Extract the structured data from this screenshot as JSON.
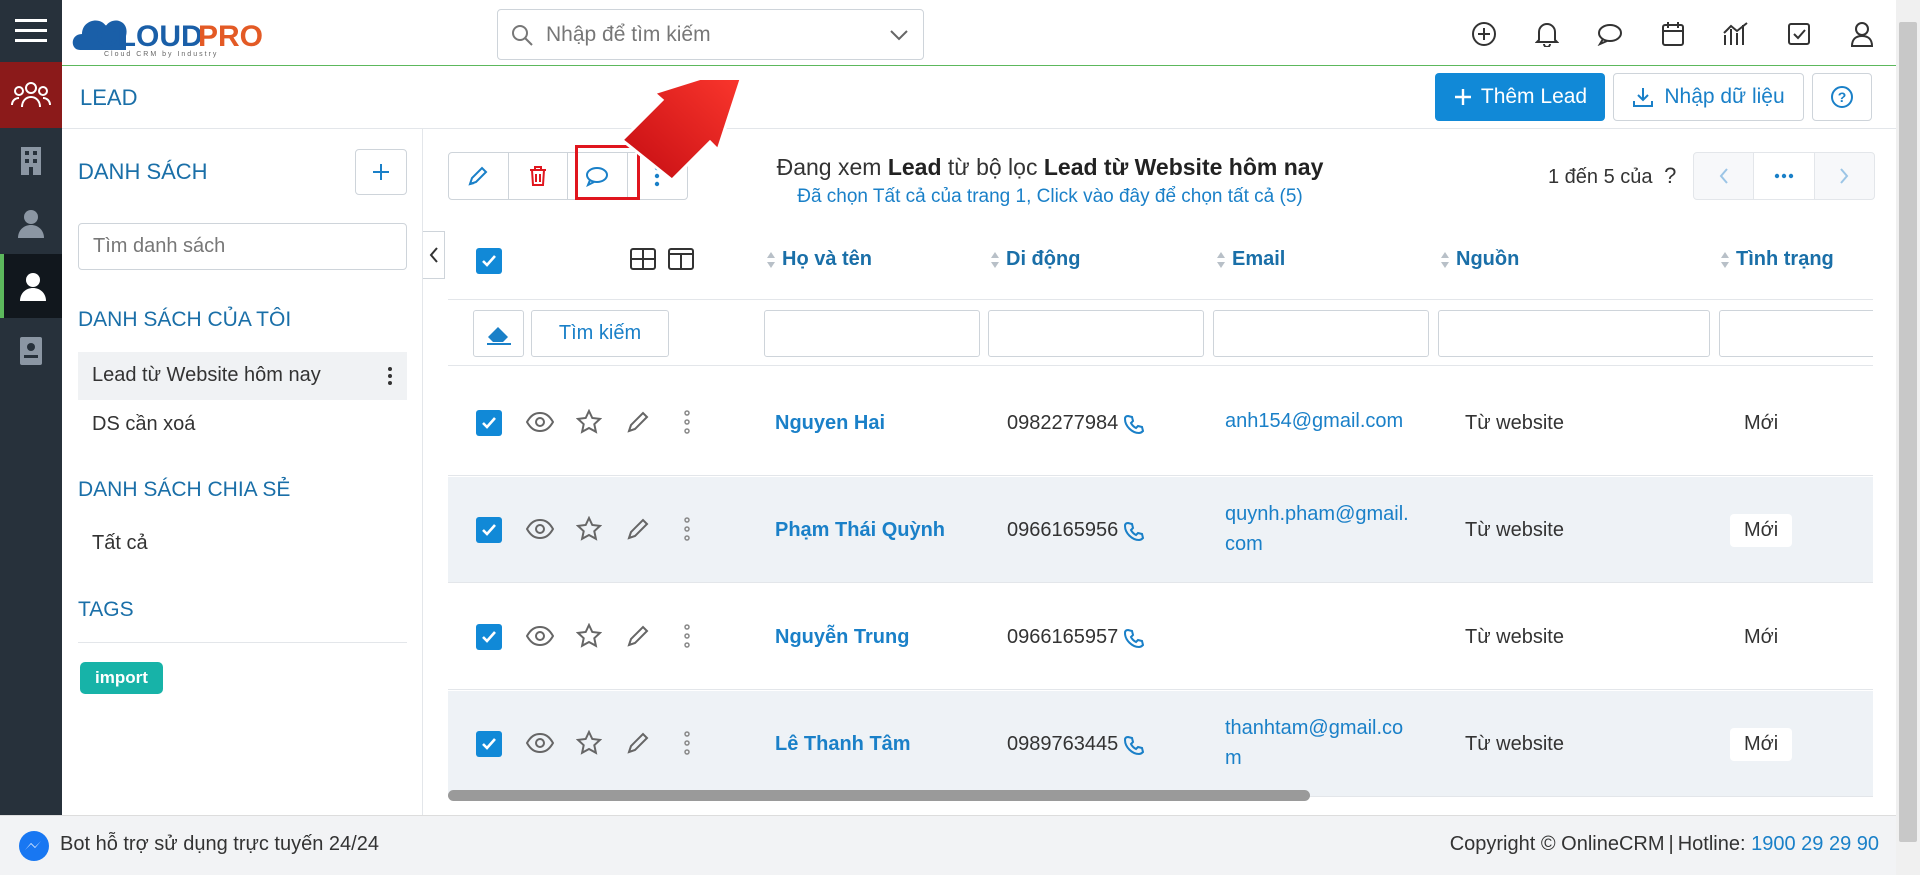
{
  "app": {
    "logo_text": "CLOUDPRO",
    "logo_tagline": "Cloud CRM by Industry"
  },
  "search": {
    "placeholder": "Nhập để tìm kiếm"
  },
  "page": {
    "title": "LEAD"
  },
  "actions": {
    "add_lead": "Thêm Lead",
    "import": "Nhập dữ liệu"
  },
  "left_panel": {
    "header": "DANH SÁCH",
    "search_placeholder": "Tìm danh sách",
    "my_lists_title": "DANH SÁCH CỦA TÔI",
    "my_lists": [
      "Lead từ Website hôm nay",
      "DS cần xoá"
    ],
    "shared_title": "DANH SÁCH CHIA SẺ",
    "shared_lists": [
      "Tất cả"
    ],
    "tags_title": "TAGS",
    "tags": [
      "import"
    ]
  },
  "toolbar": {
    "viewing_prefix": "Đang xem",
    "viewing_module": "Lead",
    "viewing_mid": "từ bộ lọc",
    "viewing_filter": "Lead từ Website hôm nay",
    "selection_info": "Đã chọn Tất cả của trang 1, Click vào đây để chọn tất cả (5)"
  },
  "pagination": {
    "range": "1 đến 5 của",
    "unknown": "?"
  },
  "table": {
    "columns": [
      "Họ và tên",
      "Di động",
      "Email",
      "Nguồn",
      "Tình trạng"
    ],
    "search_button": "Tìm kiếm",
    "rows": [
      {
        "name": "Nguyen Hai",
        "phone": "0982277984",
        "email_l1": "anh154@gmail.com",
        "email_l2": "",
        "source": "Từ website",
        "status": "Mới"
      },
      {
        "name": "Phạm Thái Quỳnh",
        "phone": "0966165956",
        "email_l1": "quynh.pham@gmail.",
        "email_l2": "com",
        "source": "Từ website",
        "status": "Mới"
      },
      {
        "name": "Nguyễn Trung",
        "phone": "0966165957",
        "email_l1": "",
        "email_l2": "",
        "source": "Từ website",
        "status": "Mới"
      },
      {
        "name": "Lê Thanh Tâm",
        "phone": "0989763445",
        "email_l1": "thanhtam@gmail.co",
        "email_l2": "m",
        "source": "Từ website",
        "status": "Mới"
      }
    ]
  },
  "footer": {
    "bot_text": "Bot hỗ trợ sử dụng trực tuyến 24/24",
    "copyright": "Copyright © OnlineCRM",
    "hotline_label": "Hotline:",
    "hotline": "1900 29 29 90"
  },
  "colors": {
    "primary": "#1189d7",
    "rail": "#27313b",
    "active_rail": "#8b1a1a",
    "highlight": "#e0161e",
    "tag": "#17b3a8"
  },
  "icons": [
    "menu-icon",
    "group-icon",
    "building-icon",
    "contact-icon",
    "user-icon",
    "document-icon",
    "search-icon",
    "chevron-down-icon",
    "plus-circle-icon",
    "bell-icon",
    "chat-icon",
    "calendar-icon",
    "chart-icon",
    "checkbox-icon",
    "profile-icon",
    "help-icon",
    "download-icon",
    "pencil-icon",
    "trash-icon",
    "more-vertical-icon",
    "eye-icon",
    "star-icon",
    "phone-icon",
    "eraser-icon",
    "grid-icon",
    "columns-icon",
    "messenger-icon",
    "red-arrow-annotation"
  ]
}
